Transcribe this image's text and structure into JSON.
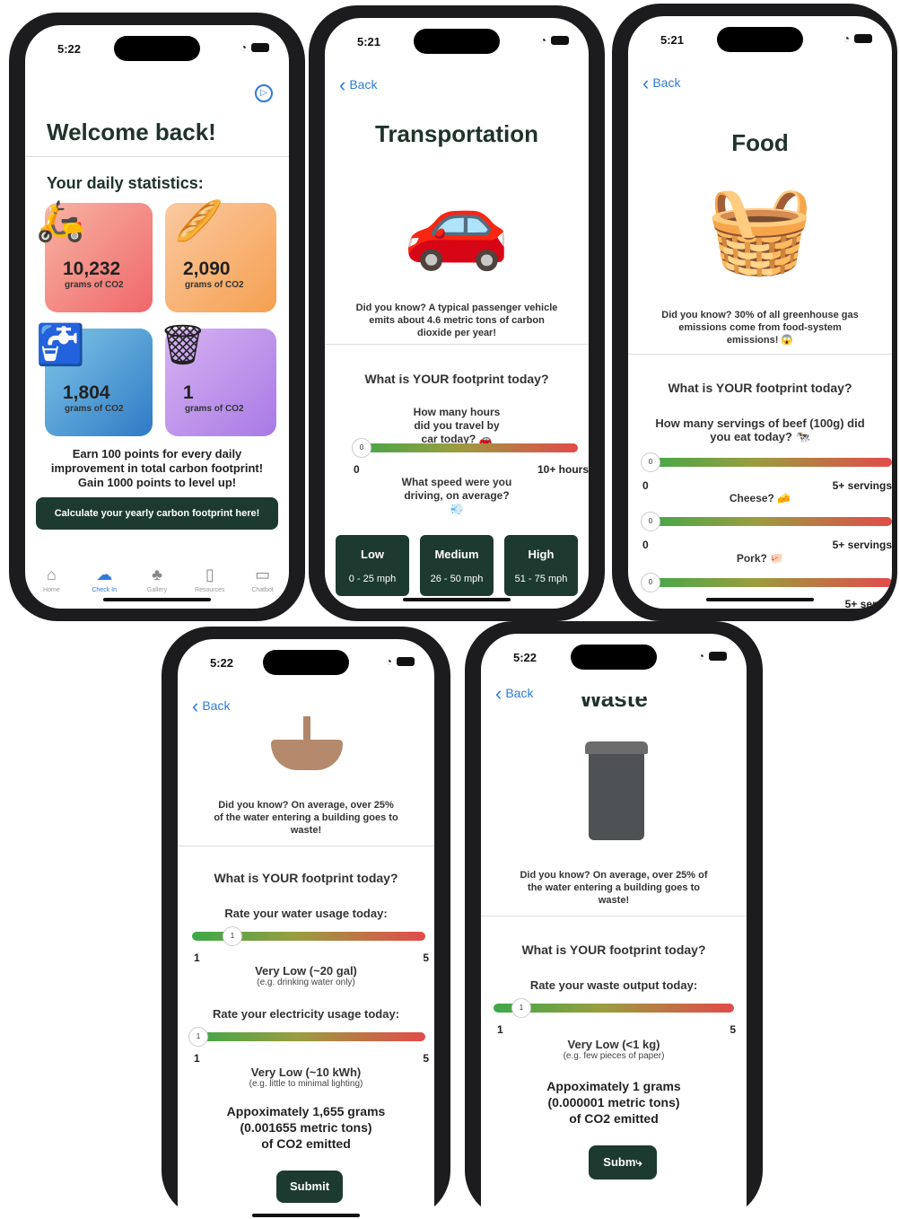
{
  "status": {
    "time_a": "5:22",
    "time_b": "5:21"
  },
  "home": {
    "welcome": "Welcome back!",
    "stats_title": "Your daily statistics:",
    "tiles": [
      {
        "value": "10,232",
        "unit": "grams of CO2"
      },
      {
        "value": "2,090",
        "unit": "grams of CO2"
      },
      {
        "value": "1,804",
        "unit": "grams of CO2"
      },
      {
        "value": "1",
        "unit": "grams of CO2"
      }
    ],
    "points_text": "Earn 100 points for every daily improvement in total carbon footprint! Gain 1000 points to level up!",
    "cta": "Calculate your yearly carbon footprint here!",
    "tabs": [
      "Home",
      "Check In",
      "Gallery",
      "Resources",
      "Chatbot"
    ]
  },
  "common": {
    "back": "Back",
    "question": "What is YOUR footprint today?",
    "submit": "Submit"
  },
  "transport": {
    "title": "Transportation",
    "fact": "Did you know? A typical passenger vehicle emits about 4.6 metric tons of carbon dioxide per year!",
    "hours_q": "How many hours did you travel by car today? 🚗",
    "min": "0",
    "max": "10+ hours",
    "knob": "0",
    "speed_q": "What speed were you driving, on average? 💨",
    "speeds": [
      {
        "name": "Low",
        "range": "0 - 25 mph"
      },
      {
        "name": "Medium",
        "range": "26 - 50 mph"
      },
      {
        "name": "High",
        "range": "51 - 75 mph"
      }
    ]
  },
  "food": {
    "title": "Food",
    "fact": "Did you know? 30% of all greenhouse gas emissions come from food-system emissions! 😱",
    "beef_q": "How many servings of beef (100g) did you eat today? 🐄",
    "cheese_q": "Cheese? 🧀",
    "pork_q": "Pork? 🐖",
    "min": "0",
    "max": "5+ servings",
    "max_cut": "5+ servin",
    "knob": "0"
  },
  "water": {
    "fact": "Did you know? On average, over 25% of the water entering a building goes to waste!",
    "water_q": "Rate your water usage today:",
    "water_level": "Very Low (~20 gal)",
    "water_eg": "(e.g. drinking water only)",
    "elec_q": "Rate your electricity usage today:",
    "elec_level": "Very Low (~10 kWh)",
    "elec_eg": "(e.g. little to minimal lighting)",
    "min": "1",
    "max": "5",
    "knob": "1",
    "result1": "Appoximately 1,655 grams",
    "result2": "(0.001655 metric tons)",
    "result3": "of CO2 emitted"
  },
  "waste": {
    "title": "Waste",
    "fact": "Did you know? On average, over 25% of the water entering a building goes to waste!",
    "waste_q": "Rate your waste output today:",
    "level": "Very Low (<1 kg)",
    "eg": "(e.g. few pieces of paper)",
    "min": "1",
    "max": "5",
    "knob": "1",
    "result1": "Appoximately 1 grams",
    "result2": "(0.000001 metric tons)",
    "result3": "of CO2 emitted",
    "submit_cut": "Subm"
  }
}
